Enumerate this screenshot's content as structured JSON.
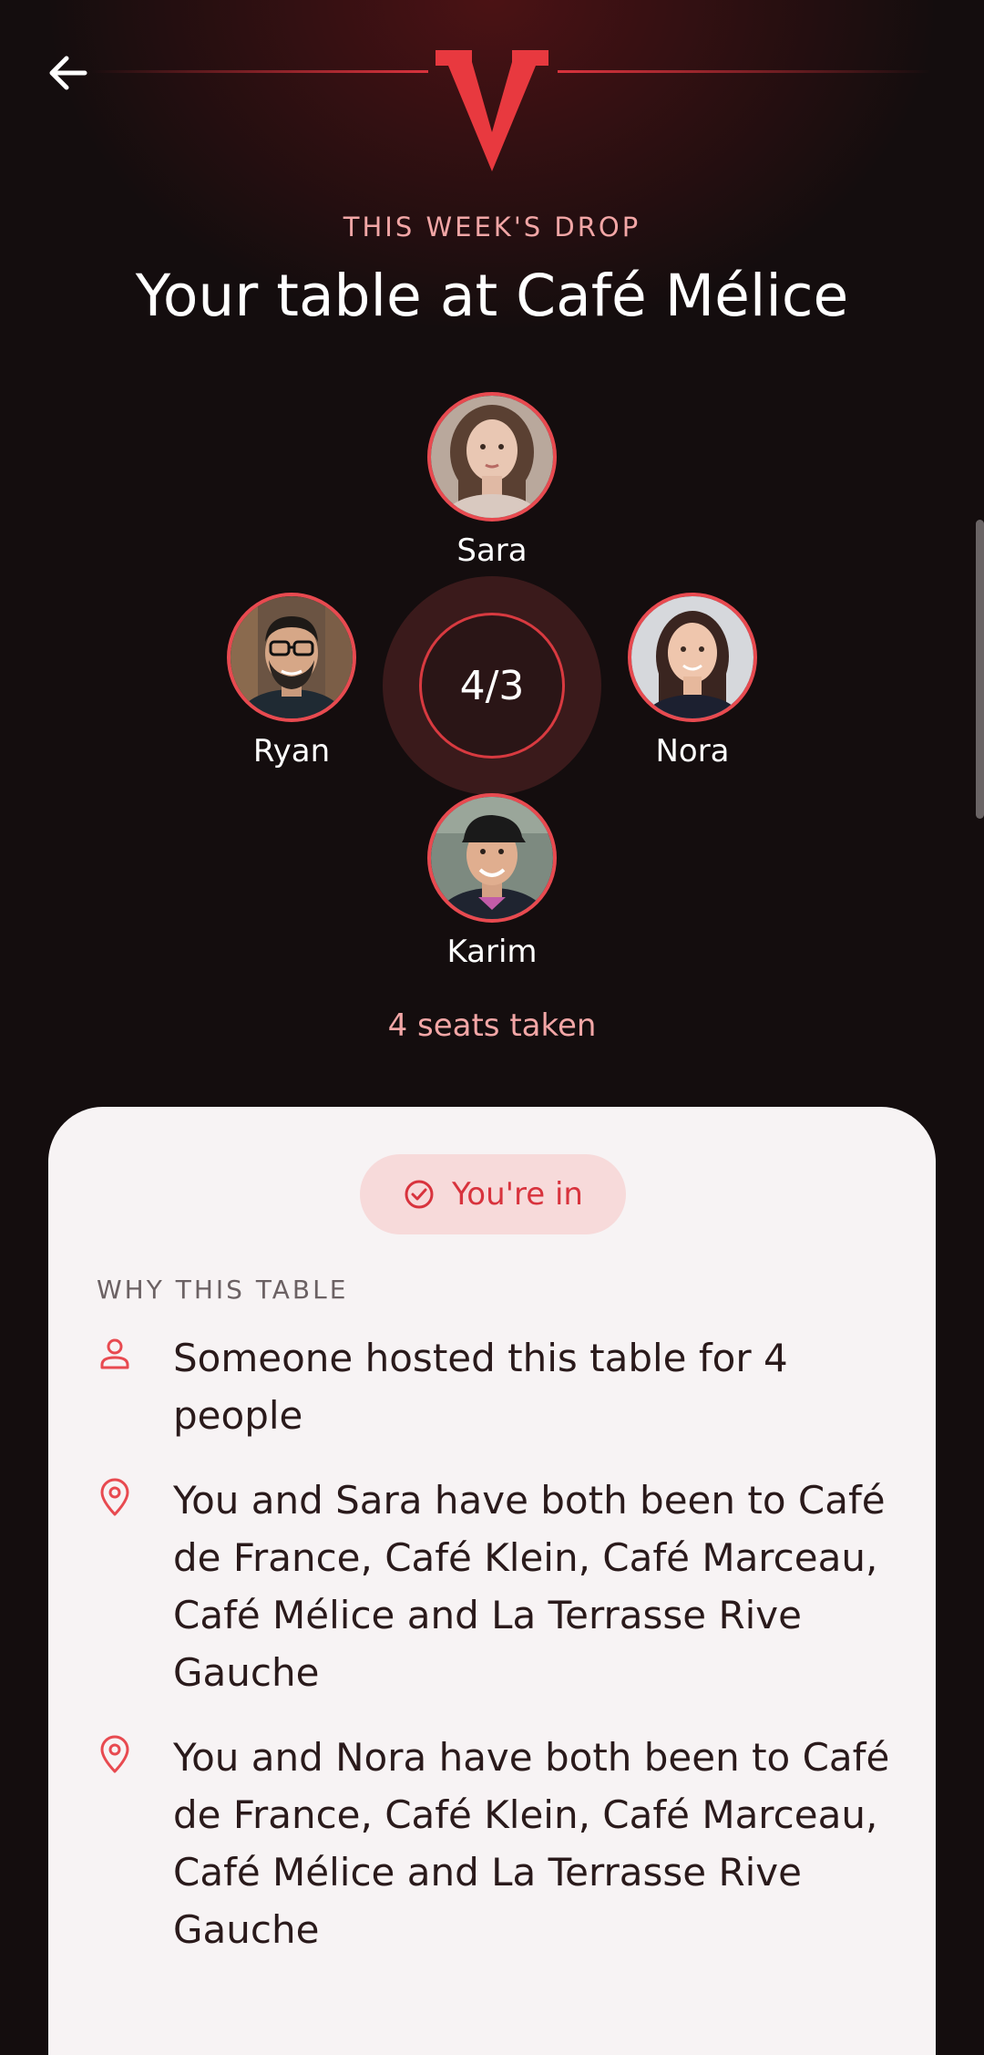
{
  "header": {
    "back_icon": "arrow-left-icon",
    "logo_icon": "v-logo-icon",
    "accent": "#e63946"
  },
  "hero": {
    "kicker": "THIS WEEK'S DROP",
    "title": "Your table at Café Mélice"
  },
  "table": {
    "count": "4/3",
    "seats": [
      {
        "name": "Sara"
      },
      {
        "name": "Ryan"
      },
      {
        "name": "Nora"
      },
      {
        "name": "Karim"
      }
    ],
    "seats_taken": "4 seats taken"
  },
  "card": {
    "status_label": "You're in",
    "status_icon": "check-circle-icon",
    "section_title": "WHY THIS TABLE",
    "reasons": [
      {
        "icon": "person-icon",
        "text": "Someone hosted this table for 4 people"
      },
      {
        "icon": "map-pin-icon",
        "text": "You and Sara have both been to Café de France, Café Klein, Café Marceau, Café Mélice and La Terrasse Rive Gauche"
      },
      {
        "icon": "map-pin-icon",
        "text": "You and Nora have both been to Café de France, Café Klein, Café Marceau, Café Mélice and La Terrasse Rive Gauche"
      }
    ]
  }
}
